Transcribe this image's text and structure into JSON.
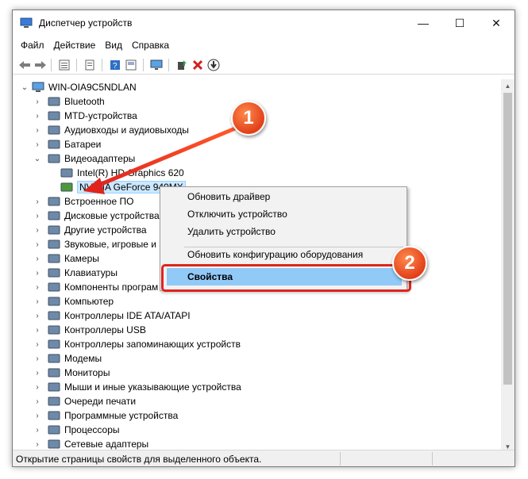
{
  "window": {
    "title": "Диспетчер устройств",
    "controls": {
      "minimize": "—",
      "maximize": "☐",
      "close": "✕"
    }
  },
  "menu": [
    "Файл",
    "Действие",
    "Вид",
    "Справка"
  ],
  "toolbar": {
    "buttons": [
      "back-icon",
      "forward-icon",
      "tree-view-icon",
      "properties-icon",
      "help-icon",
      "device-view-icon",
      "monitor-icon",
      "add-driver-icon",
      "remove-icon",
      "download-icon"
    ]
  },
  "tree": {
    "root": "WIN-OIA9C5NDLAN",
    "items": [
      {
        "label": "Bluetooth",
        "icon": "bluetooth-icon"
      },
      {
        "label": "MTD-устройства",
        "icon": "mtd-icon"
      },
      {
        "label": "Аудиовходы и аудиовыходы",
        "icon": "speaker-icon"
      },
      {
        "label": "Батареи",
        "icon": "battery-icon"
      },
      {
        "label": "Видеоадаптеры",
        "icon": "display-adapter-icon",
        "expanded": true
      },
      {
        "label": "Intel(R) HD Graphics 620",
        "icon": "gpu-icon",
        "child": true
      },
      {
        "label": "NVIDIA GeForce 940MX",
        "icon": "gpu-icon",
        "child": true,
        "selected": true
      },
      {
        "label": "Встроенное ПО",
        "icon": "firmware-icon"
      },
      {
        "label": "Дисковые устройства",
        "icon": "disk-icon"
      },
      {
        "label": "Другие устройства",
        "icon": "other-devices-icon"
      },
      {
        "label": "Звуковые, игровые и",
        "icon": "sound-icon"
      },
      {
        "label": "Камеры",
        "icon": "camera-icon"
      },
      {
        "label": "Клавиатуры",
        "icon": "keyboard-icon"
      },
      {
        "label": "Компоненты програм",
        "icon": "software-components-icon"
      },
      {
        "label": "Компьютер",
        "icon": "computer-icon"
      },
      {
        "label": "Контроллеры IDE ATA/ATAPI",
        "icon": "ide-icon"
      },
      {
        "label": "Контроллеры USB",
        "icon": "usb-icon"
      },
      {
        "label": "Контроллеры запоминающих устройств",
        "icon": "storage-icon"
      },
      {
        "label": "Модемы",
        "icon": "modem-icon"
      },
      {
        "label": "Мониторы",
        "icon": "monitor-icon"
      },
      {
        "label": "Мыши и иные указывающие устройства",
        "icon": "mouse-icon"
      },
      {
        "label": "Очереди печати",
        "icon": "printer-icon"
      },
      {
        "label": "Программные устройства",
        "icon": "software-device-icon"
      },
      {
        "label": "Процессоры",
        "icon": "cpu-icon"
      },
      {
        "label": "Сетевые адаптеры",
        "icon": "network-icon"
      }
    ]
  },
  "context_menu": {
    "items": [
      "Обновить драйвер",
      "Отключить устройство",
      "Удалить устройство"
    ],
    "scan": "Обновить конфигурацию оборудования",
    "properties": "Свойства"
  },
  "callouts": {
    "step1": "1",
    "step2": "2"
  },
  "status": {
    "text": "Открытие страницы свойств для выделенного объекта."
  },
  "colors": {
    "accent_red": "#e0241d",
    "badge_orange": "#f05a28",
    "highlight": "#91c9f7"
  }
}
